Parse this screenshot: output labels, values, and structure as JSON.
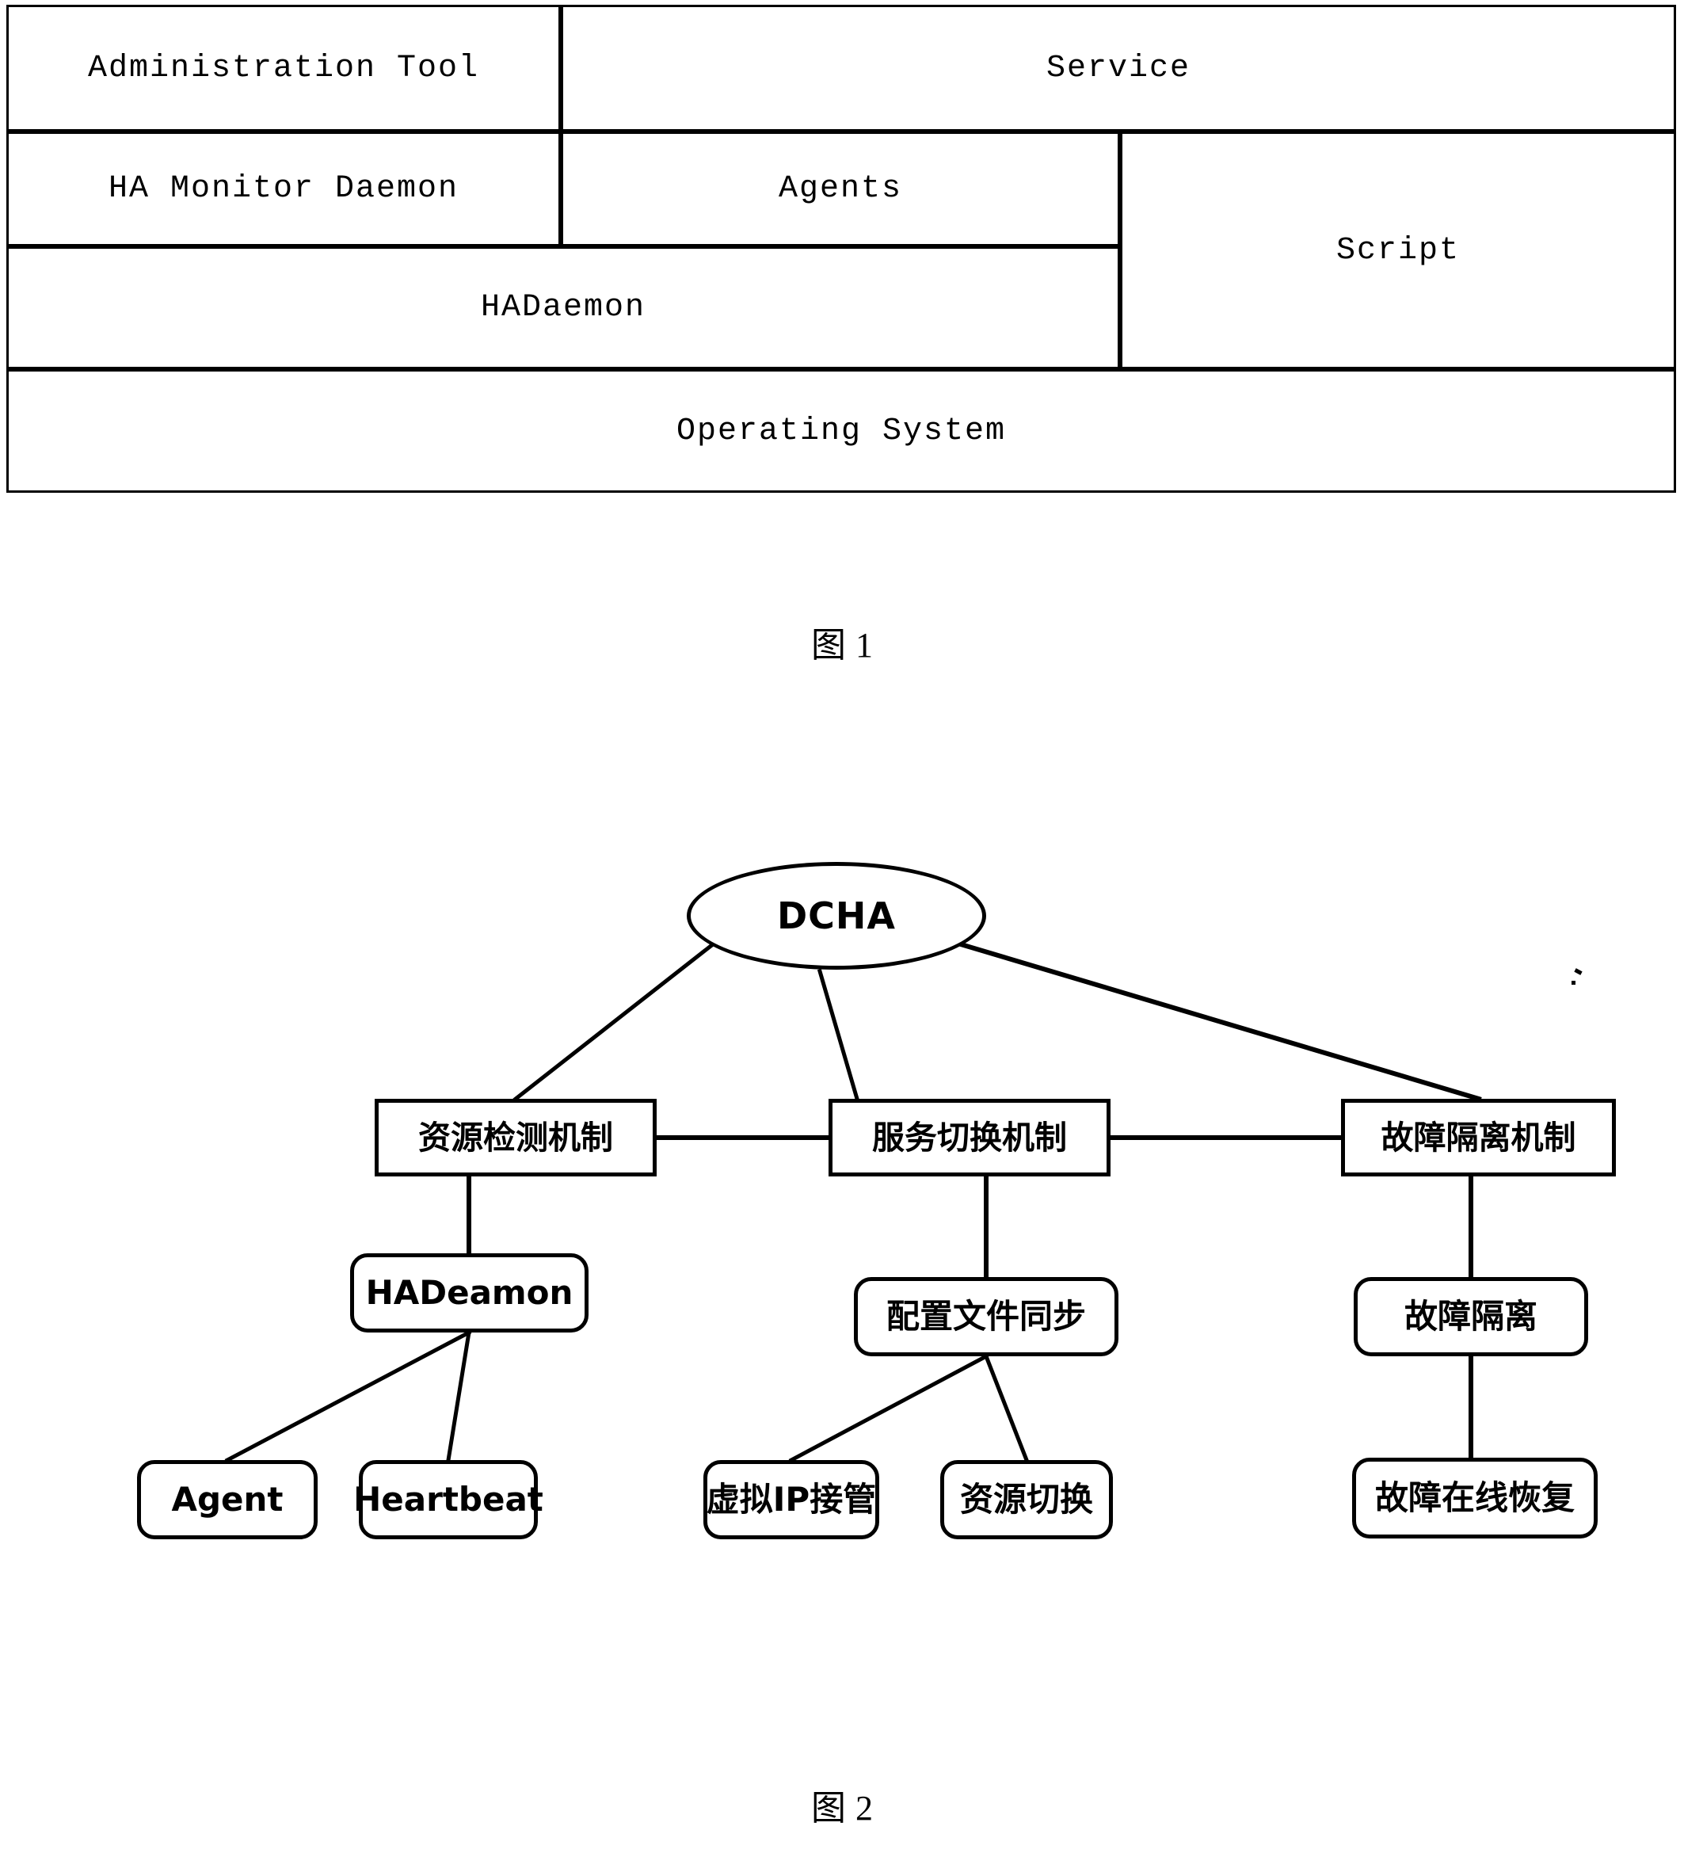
{
  "figure1": {
    "caption_label": "图",
    "caption_number": "1",
    "rows": [
      {
        "cells": [
          {
            "name": "admin-tool",
            "label": "Administration Tool"
          },
          {
            "name": "service",
            "label": "Service"
          }
        ]
      },
      {
        "cells": [
          {
            "name": "ha-monitor-daemon",
            "label": "HA Monitor Daemon"
          },
          {
            "name": "agents",
            "label": "Agents"
          },
          {
            "name": "script",
            "label": "Script"
          }
        ]
      },
      {
        "cells": [
          {
            "name": "hadaemon",
            "label": "HADaemon"
          }
        ]
      },
      {
        "cells": [
          {
            "name": "operating-system",
            "label": "Operating System"
          }
        ]
      }
    ],
    "cell_labels": {
      "admin_tool": "Administration Tool",
      "service": "Service",
      "ha_monitor_daemon": "HA Monitor Daemon",
      "agents": "Agents",
      "script": "Script",
      "hadaemon": "HADaemon",
      "operating_system": "Operating System"
    }
  },
  "figure2": {
    "caption_label": "图",
    "caption_number": "2",
    "root": {
      "label": "DCHA",
      "shape": "ellipse"
    },
    "level1": {
      "resource_detect": "资源检测机制",
      "service_switch": "服务切换机制",
      "fault_isolate": "故障隔离机制"
    },
    "level2": {
      "hadeamon": "HADeamon",
      "config_sync": "配置文件同步",
      "fault_isolation": "故障隔离"
    },
    "level3": {
      "agent": "Agent",
      "heartbeat": "Heartbeat",
      "virtual_ip": "虚拟IP接管",
      "resource_switch": "资源切换",
      "online_recovery": "故障在线恢复"
    },
    "edges": [
      {
        "from": "DCHA",
        "to": "资源检测机制"
      },
      {
        "from": "DCHA",
        "to": "服务切换机制"
      },
      {
        "from": "DCHA",
        "to": "故障隔离机制"
      },
      {
        "from": "资源检测机制",
        "to": "服务切换机制"
      },
      {
        "from": "服务切换机制",
        "to": "故障隔离机制"
      },
      {
        "from": "资源检测机制",
        "to": "HADeamon"
      },
      {
        "from": "服务切换机制",
        "to": "配置文件同步"
      },
      {
        "from": "故障隔离机制",
        "to": "故障隔离"
      },
      {
        "from": "HADeamon",
        "to": "Agent"
      },
      {
        "from": "HADeamon",
        "to": "Heartbeat"
      },
      {
        "from": "配置文件同步",
        "to": "虚拟IP接管"
      },
      {
        "from": "配置文件同步",
        "to": "资源切换"
      },
      {
        "from": "故障隔离",
        "to": "故障在线恢复"
      }
    ]
  },
  "colors": {
    "ink": "#000000",
    "paper": "#ffffff"
  }
}
